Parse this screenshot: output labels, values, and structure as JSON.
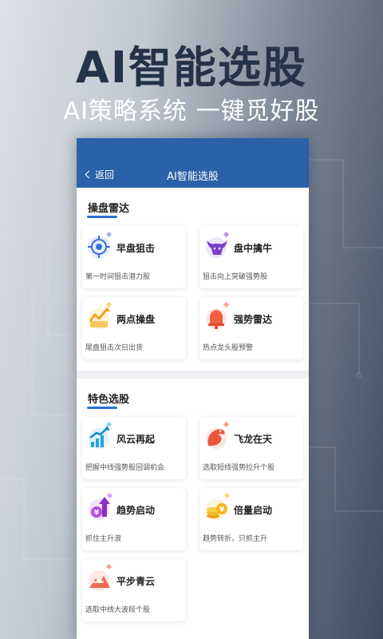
{
  "hero": {
    "title": "AI智能选股",
    "subtitle": "AI策略系统  一键觅好股"
  },
  "app": {
    "back_label": "返回",
    "title": "AI智能选股"
  },
  "sections": [
    {
      "title": "操盘雷达",
      "cards": [
        {
          "title": "早盘狙击",
          "desc": "第一时间狙击潜力股",
          "icon": "target-icon"
        },
        {
          "title": "盘中擒牛",
          "desc": "狙击向上突破强势股",
          "icon": "bull-icon"
        },
        {
          "title": "两点操盘",
          "desc": "尾盘狙击次日出货",
          "icon": "trend-chart-icon"
        },
        {
          "title": "强势雷达",
          "desc": "热点龙头股预警",
          "icon": "bell-icon"
        }
      ]
    },
    {
      "title": "特色选股",
      "cards": [
        {
          "title": "风云再起",
          "desc": "把握中线强势股回调机会",
          "icon": "rising-bars-icon"
        },
        {
          "title": "飞龙在天",
          "desc": "选取短线强势拉升个股",
          "icon": "dragon-icon"
        },
        {
          "title": "趋势启动",
          "desc": "抓住主升浪",
          "icon": "yen-arrow-icon"
        },
        {
          "title": "倍量启动",
          "desc": "趋势转折，只抓主升",
          "icon": "coin-stack-icon"
        },
        {
          "title": "平步青云",
          "desc": "选取中线大波段个股",
          "icon": "mountain-cloud-icon"
        }
      ]
    }
  ],
  "colors": {
    "header_blue": "#2a61a8",
    "accent_blue": "#2a6fd6",
    "hero_title": "#24324a"
  }
}
